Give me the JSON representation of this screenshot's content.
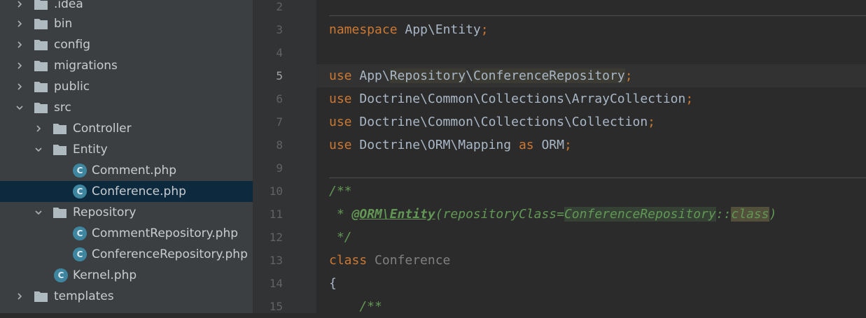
{
  "project_tree": {
    "items": [
      {
        "label": ".idea",
        "kind": "folder",
        "expanded": false
      },
      {
        "label": "bin",
        "kind": "folder",
        "expanded": false
      },
      {
        "label": "config",
        "kind": "folder",
        "expanded": false
      },
      {
        "label": "migrations",
        "kind": "folder",
        "expanded": false
      },
      {
        "label": "public",
        "kind": "folder",
        "expanded": false
      },
      {
        "label": "src",
        "kind": "folder",
        "expanded": true
      },
      {
        "label": "Controller",
        "kind": "folder",
        "expanded": false
      },
      {
        "label": "Entity",
        "kind": "folder",
        "expanded": true
      },
      {
        "label": "Comment.php",
        "kind": "php-class-file"
      },
      {
        "label": "Conference.php",
        "kind": "php-class-file",
        "selected": true
      },
      {
        "label": "Repository",
        "kind": "folder",
        "expanded": true
      },
      {
        "label": "CommentRepository.php",
        "kind": "php-class-file"
      },
      {
        "label": "ConferenceRepository.php",
        "kind": "php-class-file"
      },
      {
        "label": "Kernel.php",
        "kind": "php-class-file"
      },
      {
        "label": "templates",
        "kind": "folder",
        "expanded": false
      }
    ],
    "class_icon_letter": "C"
  },
  "editor": {
    "current_line": 5,
    "line_numbers": [
      "2",
      "3",
      "4",
      "5",
      "6",
      "7",
      "8",
      "9",
      "10",
      "11",
      "12",
      "13",
      "14",
      "15"
    ],
    "lines": {
      "l3": {
        "t1": "namespace",
        "t2": " App\\Entity",
        "t3": ";"
      },
      "l5": {
        "t1": "use",
        "t2": " App",
        "t3": "\\",
        "t4": "Repository",
        "t5": "\\",
        "t6": "ConferenceRepository",
        "t7": ";"
      },
      "l6": {
        "t1": "use",
        "t2": " Doctrine\\Common\\Collections\\ArrayCollection",
        "t3": ";"
      },
      "l7": {
        "t1": "use",
        "t2": " Doctrine\\Common\\Collections\\Collection",
        "t3": ";"
      },
      "l8": {
        "t1": "use",
        "t2": " Doctrine\\ORM\\Mapping ",
        "t3": "as",
        "t4": " ORM",
        "t5": ";"
      },
      "l10": {
        "t1": "/**"
      },
      "l11": {
        "t1": " * ",
        "t2": "@ORM\\Entity",
        "t3": "(repositoryClass=",
        "t4": "ConferenceRepository",
        "t5": "::",
        "t6": "class",
        "t7": ")"
      },
      "l12": {
        "t1": " */"
      },
      "l13": {
        "t1": "class",
        "t2": " Conference"
      },
      "l14": {
        "t1": "{"
      },
      "l15": {
        "t1": "    /**"
      }
    }
  },
  "colors": {
    "keyword": "#cc7832",
    "identifier": "#a9b7c6",
    "doc_comment": "#629755",
    "unused": "#808080",
    "tree_background": "#3c3f41",
    "tree_selection": "#0d293e",
    "editor_background": "#2b2b2b",
    "class_icon": "#3e86a0"
  }
}
